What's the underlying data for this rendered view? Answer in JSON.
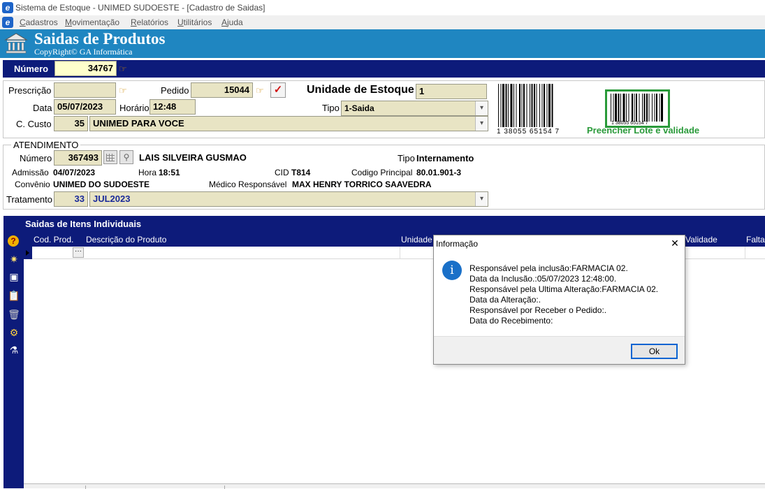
{
  "window": {
    "title": "Sistema de Estoque - UNIMED SUDOESTE - [Cadastro de Saidas]",
    "app_icon": "e-logo-icon"
  },
  "menu": [
    "Cadastros",
    "Movimentação",
    "Relatórios",
    "Utilitários",
    "Ajuda"
  ],
  "header": {
    "title": "Saidas de Produtos",
    "subtitle": "CopyRight© GA Informática",
    "icon": "building-icon",
    "color": "#1f86c1"
  },
  "numero": {
    "label": "Número",
    "value": "34767"
  },
  "form": {
    "prescricao_label": "Prescrição",
    "prescricao_value": "",
    "pedido_label": "Pedido",
    "pedido_value": "15044",
    "unidade_label": "Unidade de Estoque",
    "unidade_value": "1",
    "data_label": "Data",
    "data_value": "05/07/2023",
    "horario_label": "Horário",
    "horario_value": "12:48",
    "tipo_label": "Tipo",
    "tipo_value": "1-Saida",
    "custo_label": "C. Custo",
    "custo_code": "35",
    "custo_value": "UNIMED PARA VOCE"
  },
  "barcode": {
    "number": "1 38055 65154 7",
    "small_number": "1 38055 65154 7",
    "hint": "Preencher Lote e validade",
    "hint_color": "#2a9a3a"
  },
  "atendimento": {
    "section_label": "ATENDIMENTO",
    "numero_label": "Número",
    "numero_value": "367493",
    "patient_name": "LAIS SILVEIRA GUSMAO",
    "tipo_label": "Tipo",
    "tipo_value": "Internamento",
    "admissao_label": "Admissão",
    "admissao_value": "04/07/2023",
    "hora_label": "Hora",
    "hora_value": "18:51",
    "cid_label": "CID",
    "cid_value": "T814",
    "codigo_label": "Codigo Principal",
    "codigo_value": "80.01.901-3",
    "convenio_label": "Convênio",
    "convenio_value": "UNIMED DO SUDOESTE",
    "medico_label": "Médico Responsável",
    "medico_value": "MAX HENRY TORRICO SAAVEDRA",
    "tratamento_label": "Tratamento",
    "tratamento_code": "33",
    "tratamento_value": "JUL2023"
  },
  "items_panel": {
    "title": "Saidas de Itens Individuais",
    "columns": [
      "Cod. Prod.",
      "Descrição do Produto",
      "Unidade",
      "Validade",
      "Falta"
    ],
    "tools": [
      "help-icon",
      "new-icon",
      "save-icon",
      "clipboard-icon",
      "trash-icon",
      "settings-icon",
      "flask-icon"
    ],
    "row_button": "···"
  },
  "dialog": {
    "title": "Informação",
    "close": "✕",
    "icon": "info-icon",
    "lines": [
      "Responsável pela inclusão:FARMACIA 02.",
      "Data da Inclusão.:05/07/2023 12:48:00.",
      "Responsável pela Ultima Alteração:FARMACIA 02.",
      "Data da Alteração:.",
      "Responsável por Receber o Pedido:.",
      "Data do Recebimento:"
    ],
    "ok_label": "Ok"
  }
}
